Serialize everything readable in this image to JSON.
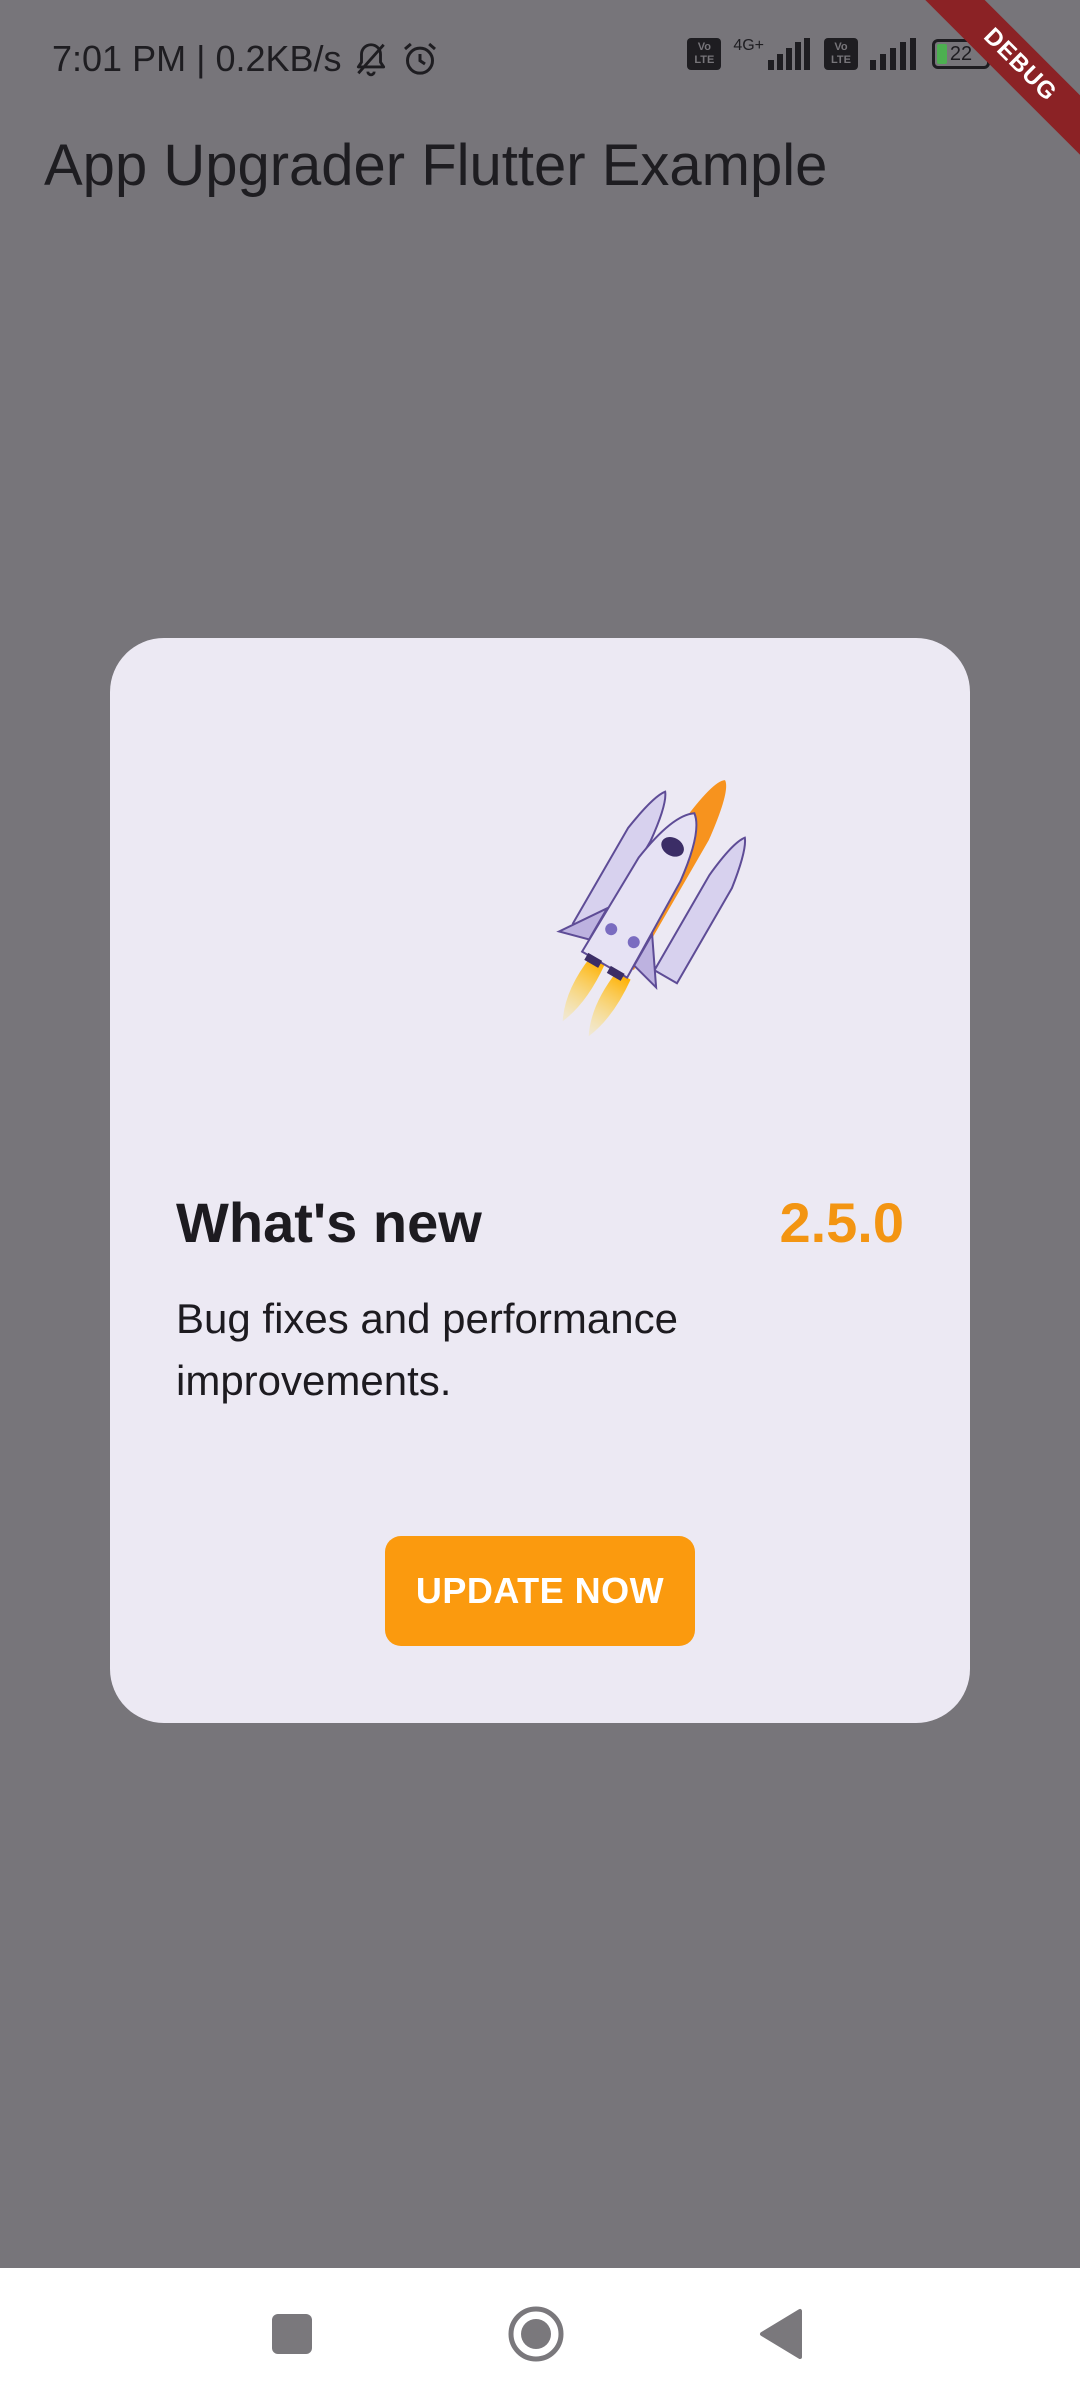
{
  "status_bar": {
    "time": "7:01 PM",
    "separator": "|",
    "speed": "0.2KB/s",
    "network_type": "4G+",
    "lte_label": "Vo LTE",
    "battery": "22",
    "icons": [
      "bell-off-icon",
      "alarm-icon",
      "volte-icon",
      "signal-icon",
      "battery-icon"
    ]
  },
  "debug_banner": "DEBUG",
  "app_bar": {
    "title": "App Upgrader Flutter Example"
  },
  "dialog": {
    "heading": "What's new",
    "version": "2.5.0",
    "release_notes": "Bug fixes and performance improvements.",
    "update_button": "UPDATE NOW",
    "illustration": "rocket-icon"
  },
  "nav_bar": {
    "buttons": [
      "recents-button",
      "home-button",
      "back-button"
    ]
  },
  "colors": {
    "scrim": "#77757a",
    "dialog_bg": "#ece9f3",
    "accent": "#fb9a0e",
    "version_text": "#f39512",
    "debug_banner": "#8b2225"
  }
}
